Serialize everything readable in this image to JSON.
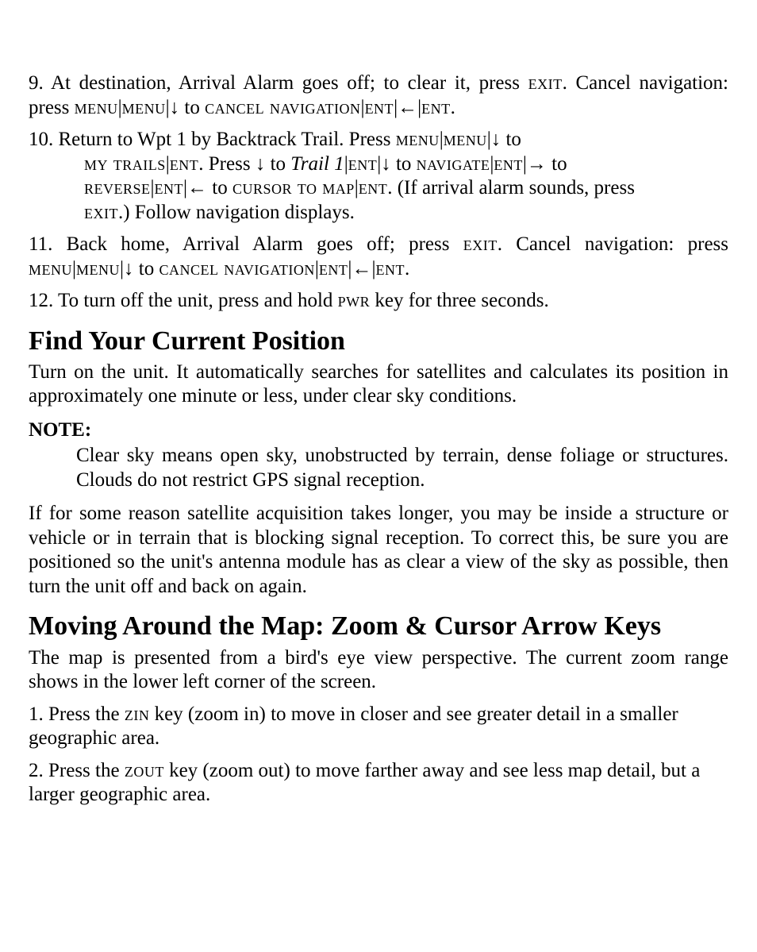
{
  "steps": {
    "s9": {
      "prefix": "9. At destination, Arrival Alarm goes off; to clear it, press ",
      "exit1": "exit",
      "after_exit1": ". Cancel navigation: press ",
      "menu": "menu",
      "pipe1": "|",
      "menu2": "menu",
      "pipe2": "|",
      "arrow_down": "↓",
      "to1": " to ",
      "cancel_nav": "cancel navigation",
      "pipe3": "|",
      "ent1": "ent",
      "pipe4": "|",
      "arrow_left": "←",
      "pipe5": "|",
      "ent2": "ent",
      "period": "."
    },
    "s10": {
      "l1_pre": "10. Return to Wpt 1 by Backtrack Trail. Press ",
      "menu": "menu",
      "pipe1": "|",
      "menu2": "menu",
      "pipe2": "|",
      "arrow_down1": "↓",
      "to1": " to ",
      "l2_pre": "my trails",
      "pipe3": "|",
      "ent1": "ent",
      "press_down": ". Press ",
      "arrow_down2": "↓",
      "to2": " to ",
      "trail1": "Trail 1",
      "pipe4": "|",
      "ent2": "ent",
      "pipe5": "|",
      "arrow_down3": "↓",
      "to3": " to ",
      "navigate": "navigate",
      "pipe6": "|",
      "ent3": "ent",
      "pipe7": "|",
      "arrow_right": "→",
      "to4": " to ",
      "l3_pre": "reverse",
      "pipe8": "|",
      "ent4": "ent",
      "pipe9": "|",
      "arrow_left": "←",
      "to5": " to ",
      "cursor_map": "cursor to map",
      "pipe10": "|",
      "ent5": "ent",
      "if_arrival": ". (If arrival alarm sounds, press ",
      "l4_exit": "exit",
      "follow": ".) Follow navigation displays."
    },
    "s11": {
      "pre": "11. Back home, Arrival Alarm goes off; press ",
      "exit1": "exit",
      "cancel": ". Cancel navigation: press ",
      "menu": "menu",
      "pipe1": "|",
      "menu2": "menu",
      "pipe2": "|",
      "arrow_down": "↓",
      "to1": " to ",
      "cancel_nav": "cancel navigation",
      "pipe3": "|",
      "ent1": "ent",
      "pipe4": "|",
      "arrow_left": "←",
      "pipe5": "|",
      "ent2": "ent",
      "period": "."
    },
    "s12": {
      "pre": "12. To turn off the unit, press and hold ",
      "pwr": "pwr",
      "post": " key for three seconds."
    }
  },
  "section1": {
    "title": "Find Your Current Position",
    "p1": "Turn on the unit. It automatically searches for satellites and calculates its position in approximately one minute or less, under clear sky conditions.",
    "note_label": "NOTE:",
    "note_body": "Clear sky means open sky, unobstructed by terrain, dense foliage or structures. Clouds do not restrict GPS signal reception.",
    "p2": "If for some reason satellite acquisition takes longer, you may be inside a structure or vehicle or in terrain that is blocking signal reception. To correct this, be sure you are positioned so the unit's antenna module has as clear a view of the sky as possible, then turn the unit off and back on again."
  },
  "section2": {
    "title": "Moving Around the Map: Zoom & Cursor Arrow Keys",
    "p1": "The map is presented from a bird's eye view perspective. The current zoom range shows in the lower left corner of the screen.",
    "step1_pre": "1. Press the ",
    "step1_key": "zin",
    "step1_post": " key (zoom in) to move in closer and see greater detail in a smaller geographic area.",
    "step2_pre": "2. Press the ",
    "step2_key": "zout",
    "step2_post": " key (zoom out) to move farther away and see less map detail, but a larger geographic area."
  }
}
